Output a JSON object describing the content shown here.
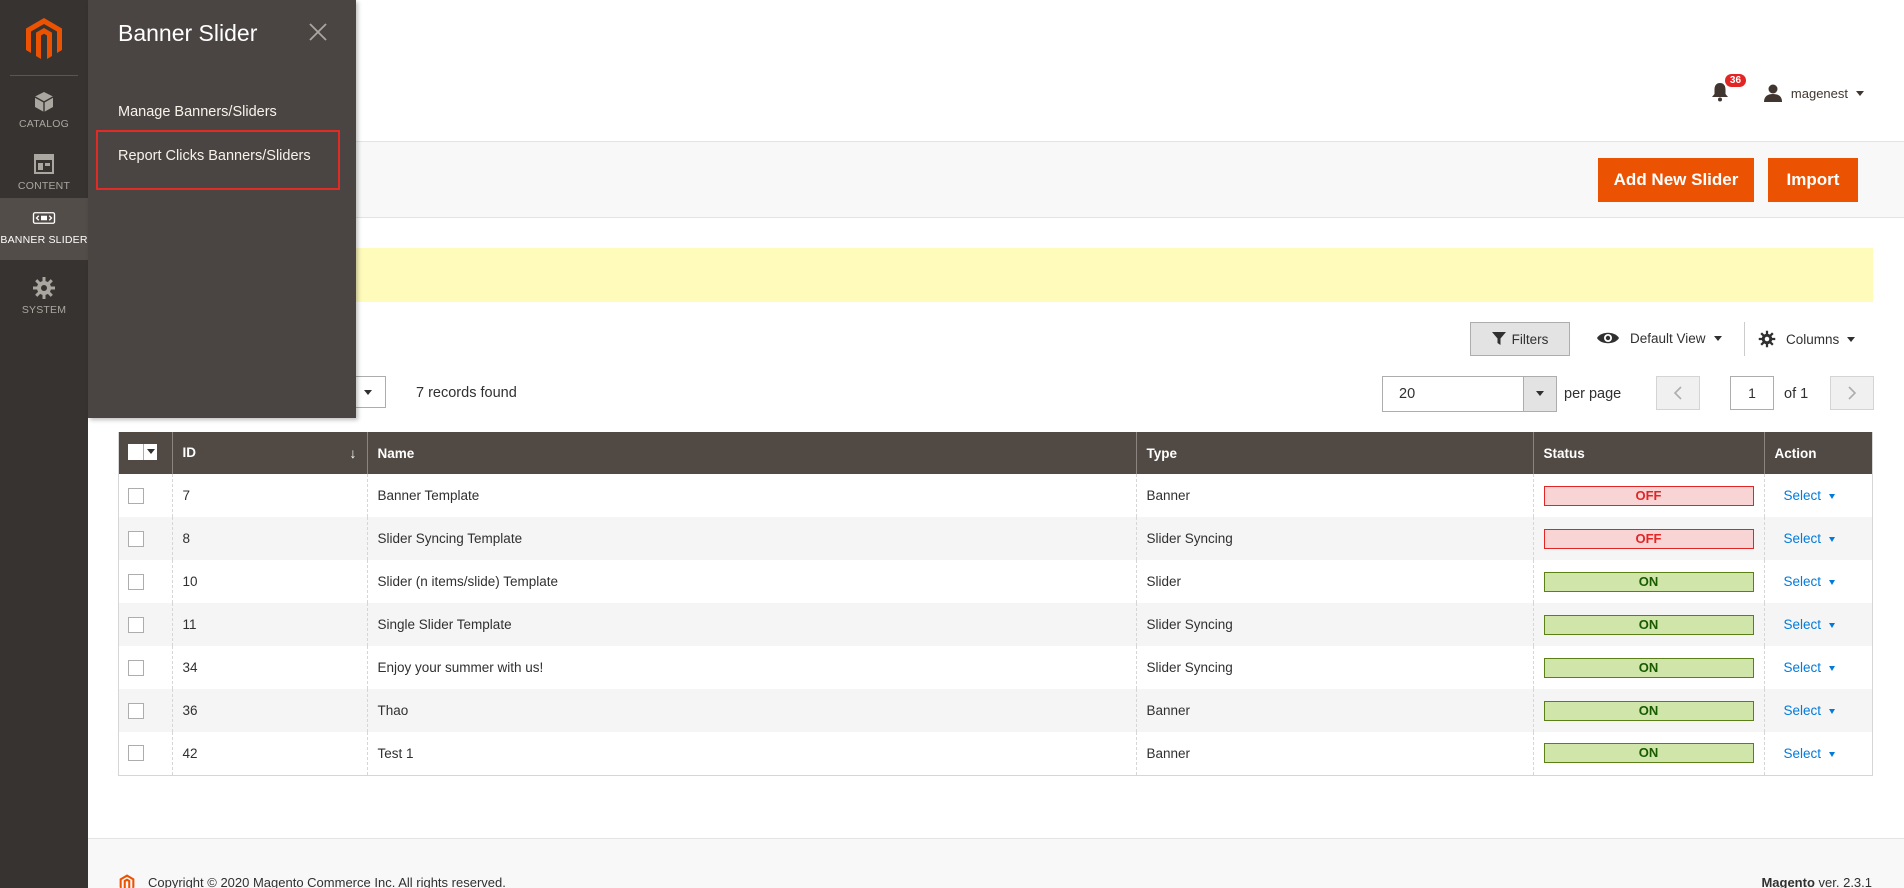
{
  "nav": {
    "items": [
      {
        "label": "CATALOG",
        "icon": "box-icon"
      },
      {
        "label": "CONTENT",
        "icon": "layout-icon"
      },
      {
        "label": "BANNER SLIDER",
        "icon": "slider-icon"
      },
      {
        "label": "SYSTEM",
        "icon": "gear-icon"
      }
    ]
  },
  "flyout": {
    "title": "Banner Slider",
    "links": [
      "Manage Banners/Sliders",
      "Report Clicks Banners/Sliders"
    ]
  },
  "header": {
    "notifications_count": "36",
    "user_name": "magenest"
  },
  "actions": {
    "add_label": "Add New Slider",
    "import_label": "Import"
  },
  "toolbar": {
    "filters_label": "Filters",
    "view_label": "Default View",
    "columns_label": "Columns",
    "records_found": "7 records found",
    "per_page_value": "20",
    "per_page_label": "per page",
    "page_current": "1",
    "page_of": "of 1"
  },
  "grid": {
    "columns": [
      "ID",
      "Name",
      "Type",
      "Status",
      "Action"
    ],
    "rows": [
      {
        "id": "7",
        "name": "Banner Template",
        "type": "Banner",
        "status": "OFF",
        "action": "Select"
      },
      {
        "id": "8",
        "name": "Slider Syncing Template",
        "type": "Slider Syncing",
        "status": "OFF",
        "action": "Select"
      },
      {
        "id": "10",
        "name": "Slider (n items/slide) Template",
        "type": "Slider",
        "status": "ON",
        "action": "Select"
      },
      {
        "id": "11",
        "name": "Single Slider Template",
        "type": "Slider Syncing",
        "status": "ON",
        "action": "Select"
      },
      {
        "id": "34",
        "name": "Enjoy your summer with us!",
        "type": "Slider Syncing",
        "status": "ON",
        "action": "Select"
      },
      {
        "id": "36",
        "name": "Thao",
        "type": "Banner",
        "status": "ON",
        "action": "Select"
      },
      {
        "id": "42",
        "name": "Test 1",
        "type": "Banner",
        "status": "ON",
        "action": "Select"
      }
    ]
  },
  "footer": {
    "copyright": "Copyright © 2020 Magento Commerce Inc. All rights reserved.",
    "brand": "Magento",
    "version": " ver. 2.3.1"
  },
  "colors": {
    "accent": "#eb5202",
    "nav_bg": "#373330",
    "flyout_bg": "#4a4542",
    "grid_header": "#514943",
    "status_on": "#d0e5a9",
    "status_off": "#f9d4d4",
    "link": "#007bdb"
  }
}
